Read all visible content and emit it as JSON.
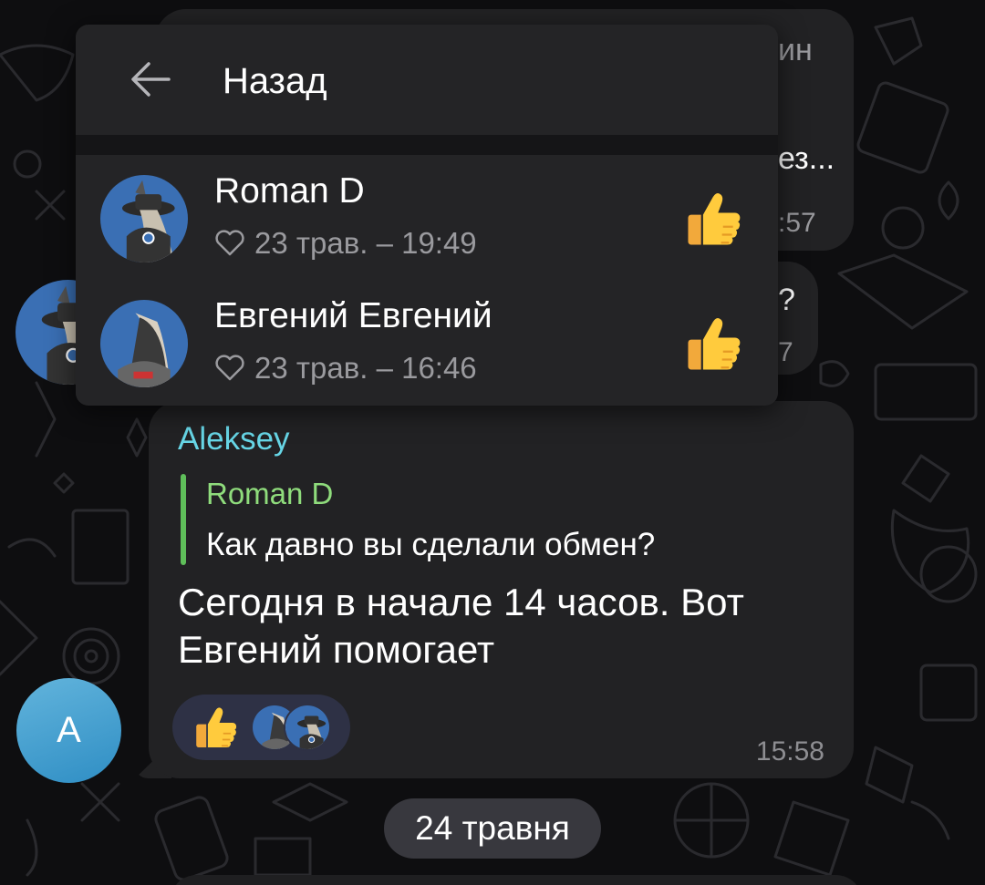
{
  "colors": {
    "background": "#0e0e10",
    "bubble": "#222224",
    "popup": "#242426",
    "sender": "#67d6e6",
    "quote_name": "#8fdc7c",
    "quote_bar": "#5fbf5a",
    "reaction_pill": "#2e3145",
    "avatar_blue": "#3a8fc4"
  },
  "popup": {
    "back_label": "Назад",
    "back_icon": "arrow-left-icon",
    "reactions": [
      {
        "name": "Roman D",
        "meta": "23 трав. – 19:49",
        "emoji": "thumbs-up"
      },
      {
        "name": "Евгений Евгений",
        "meta": "23 трав. – 16:46",
        "emoji": "thumbs-up"
      }
    ]
  },
  "background_fragments": {
    "top_right_word": "ин",
    "top_right_trunc": "ез...",
    "top_right_time": ":57",
    "mid_right_char": "?",
    "mid_right_digit": "7"
  },
  "message": {
    "sender": "Aleksey",
    "reply_name": "Roman D",
    "reply_text": "Как давно вы сделали обмен?",
    "text": "Сегодня в начале 14 часов. Вот Евгений помогает",
    "time": "15:58",
    "reaction_emoji": "thumbs-up",
    "author_initial": "A"
  },
  "date_separator": "24 травня"
}
